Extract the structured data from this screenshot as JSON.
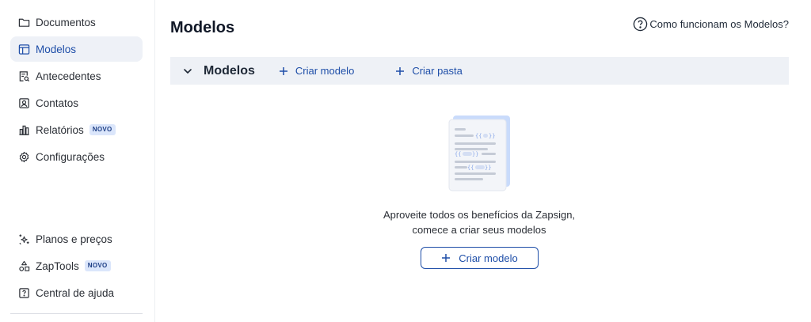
{
  "sidebar": {
    "items": [
      {
        "label": "Documentos",
        "icon": "folder-icon",
        "active": false
      },
      {
        "label": "Modelos",
        "icon": "template-icon",
        "active": true
      },
      {
        "label": "Antecedentes",
        "icon": "document-search-icon",
        "active": false
      },
      {
        "label": "Contatos",
        "icon": "contact-card-icon",
        "active": false
      },
      {
        "label": "Relatórios",
        "icon": "bar-chart-icon",
        "active": false,
        "badge": "NOVO"
      },
      {
        "label": "Configurações",
        "icon": "gear-icon",
        "active": false
      }
    ],
    "bottom_items": [
      {
        "label": "Planos e preços",
        "icon": "sparkles-icon"
      },
      {
        "label": "ZapTools",
        "icon": "shapes-icon",
        "badge": "NOVO"
      },
      {
        "label": "Central de ajuda",
        "icon": "help-square-icon"
      }
    ]
  },
  "header": {
    "title": "Modelos",
    "help_link": "Como funcionam os Modelos?"
  },
  "toolbar": {
    "section_title": "Modelos",
    "create_model": "Criar modelo",
    "create_folder": "Criar pasta"
  },
  "empty_state": {
    "line1": "Aproveite todos os benefícios da Zapsign,",
    "line2": "comece a criar seus modelos",
    "button": "Criar modelo",
    "illustration": "template-document-illustration"
  },
  "colors": {
    "accent": "#1e4ea8",
    "active_bg": "#eef1f7",
    "toolbar_bg": "#eef1f6",
    "badge_bg": "#dbe6fb"
  }
}
